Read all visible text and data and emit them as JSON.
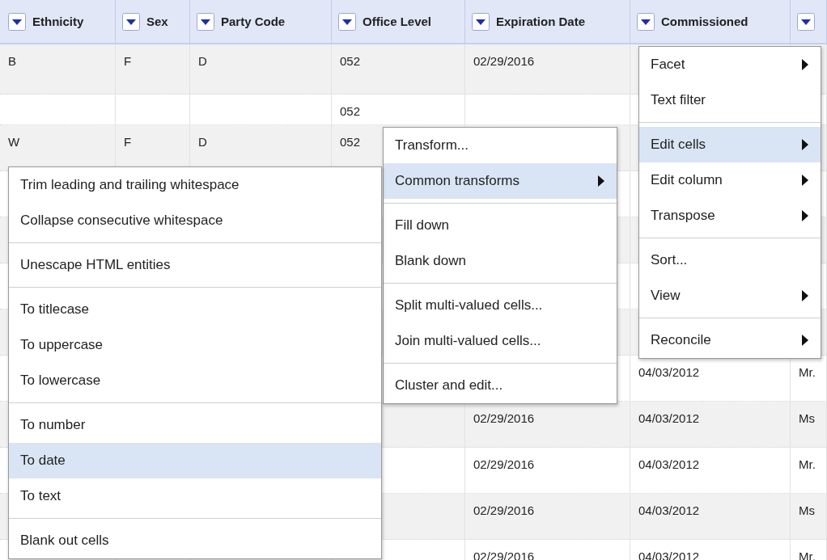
{
  "table": {
    "columns": [
      {
        "label": "Ethnicity"
      },
      {
        "label": "Sex"
      },
      {
        "label": "Party Code"
      },
      {
        "label": "Office Level"
      },
      {
        "label": "Expiration Date"
      },
      {
        "label": "Commissioned"
      },
      {}
    ],
    "rows": [
      {
        "cells": [
          "B",
          "F",
          "D",
          "052",
          "02/29/2016"
        ]
      },
      {
        "cells": [
          null,
          null,
          null,
          "052"
        ]
      },
      {
        "cells": [
          "W",
          "F",
          "D",
          "052"
        ]
      },
      {},
      {},
      {},
      {},
      {
        "cells": [
          null,
          null,
          null,
          null,
          null,
          "04/03/2012",
          "Mr."
        ]
      },
      {
        "cells": [
          null,
          null,
          null,
          null,
          "02/29/2016",
          "04/03/2012",
          "Ms"
        ]
      },
      {
        "cells": [
          null,
          null,
          null,
          null,
          "02/29/2016",
          "04/03/2012",
          "Mr."
        ]
      },
      {
        "cells": [
          null,
          null,
          null,
          null,
          "02/29/2016",
          "04/03/2012",
          "Ms"
        ]
      },
      {
        "cells": [
          null,
          null,
          null,
          null,
          "02/29/2016",
          "04/03/2012",
          "Mr."
        ]
      }
    ]
  },
  "column_menu": {
    "groups": [
      [
        {
          "label": "Facet",
          "selected": false,
          "has_submenu": true
        },
        {
          "label": "Text filter",
          "selected": false,
          "has_submenu": false
        }
      ],
      [
        {
          "label": "Edit cells",
          "selected": true,
          "has_submenu": true
        },
        {
          "label": "Edit column",
          "selected": false,
          "has_submenu": true
        },
        {
          "label": "Transpose",
          "selected": false,
          "has_submenu": true
        }
      ],
      [
        {
          "label": "Sort...",
          "selected": false,
          "has_submenu": false
        },
        {
          "label": "View",
          "selected": false,
          "has_submenu": true
        }
      ],
      [
        {
          "label": "Reconcile",
          "selected": false,
          "has_submenu": true
        }
      ]
    ]
  },
  "edit_cells_menu": {
    "groups": [
      [
        {
          "label": "Transform...",
          "selected": false,
          "has_submenu": false
        },
        {
          "label": "Common transforms",
          "selected": true,
          "has_submenu": true
        }
      ],
      [
        {
          "label": "Fill down",
          "selected": false,
          "has_submenu": false
        },
        {
          "label": "Blank down",
          "selected": false,
          "has_submenu": false
        }
      ],
      [
        {
          "label": "Split multi-valued cells...",
          "selected": false,
          "has_submenu": false
        },
        {
          "label": "Join multi-valued cells...",
          "selected": false,
          "has_submenu": false
        }
      ],
      [
        {
          "label": "Cluster and edit...",
          "selected": false,
          "has_submenu": false
        }
      ]
    ]
  },
  "common_transforms_menu": {
    "groups": [
      [
        {
          "label": "Trim leading and trailing whitespace",
          "selected": false,
          "has_submenu": false
        },
        {
          "label": "Collapse consecutive whitespace",
          "selected": false,
          "has_submenu": false
        }
      ],
      [
        {
          "label": "Unescape HTML entities",
          "selected": false,
          "has_submenu": false
        }
      ],
      [
        {
          "label": "To titlecase",
          "selected": false,
          "has_submenu": false
        },
        {
          "label": "To uppercase",
          "selected": false,
          "has_submenu": false
        },
        {
          "label": "To lowercase",
          "selected": false,
          "has_submenu": false
        }
      ],
      [
        {
          "label": "To number",
          "selected": false,
          "has_submenu": false
        },
        {
          "label": "To date",
          "selected": true,
          "has_submenu": false
        },
        {
          "label": "To text",
          "selected": false,
          "has_submenu": false
        }
      ],
      [
        {
          "label": "Blank out cells",
          "selected": false,
          "has_submenu": false
        }
      ]
    ]
  }
}
